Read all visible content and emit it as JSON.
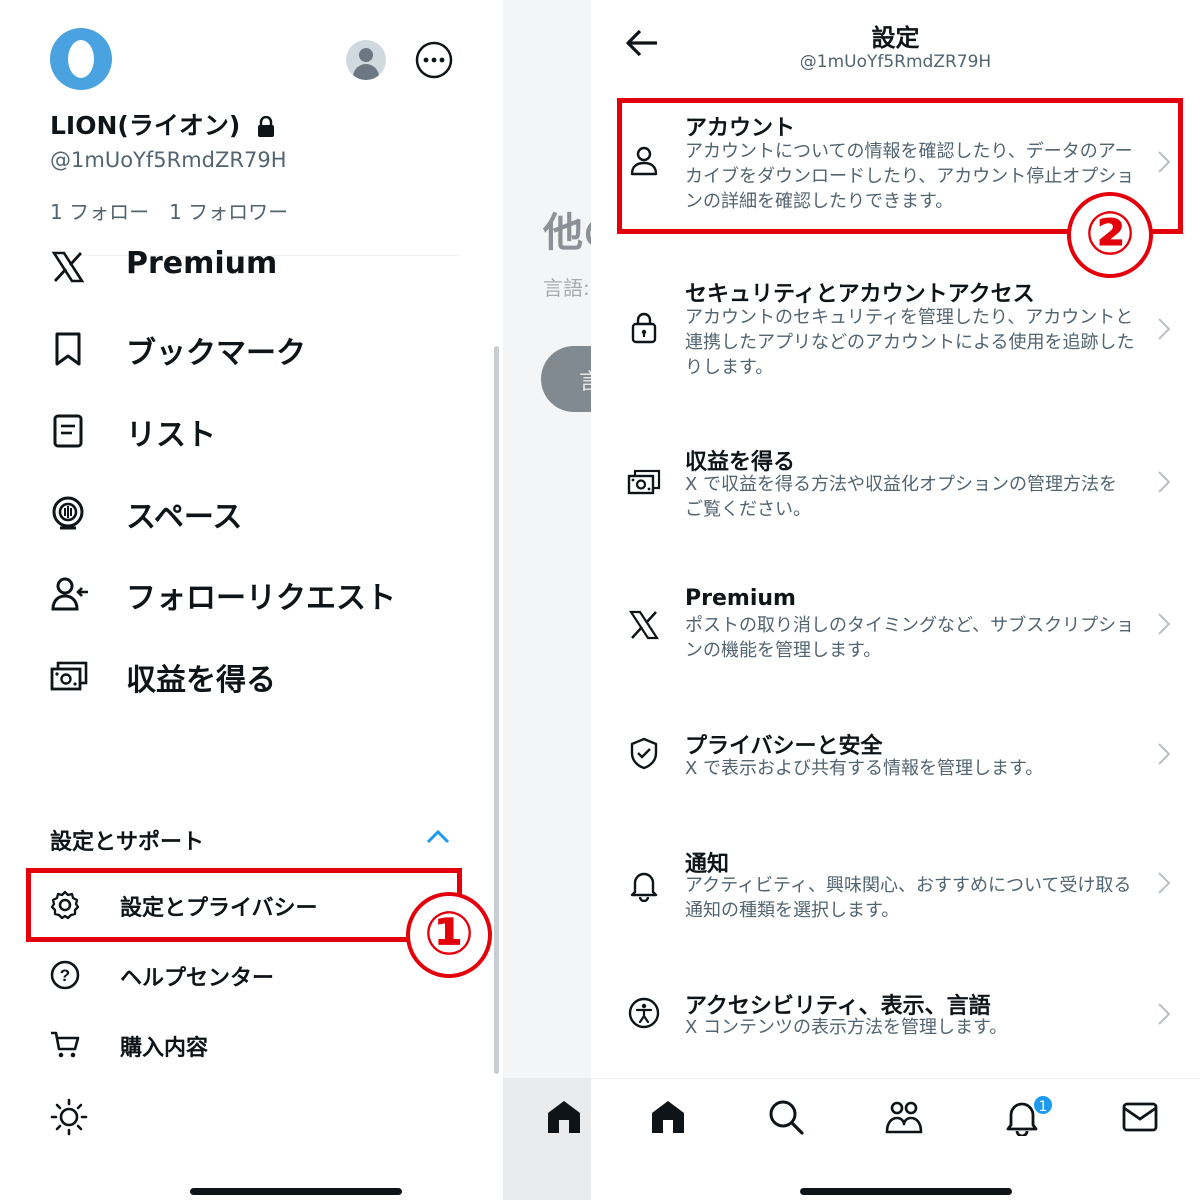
{
  "left_panel": {
    "profile": {
      "display_name": "LION(ライオン)",
      "handle": "@1mUoYf5RmdZR79H",
      "follows": "1 フォロー　1 フォロワー"
    },
    "menu": [
      {
        "label": "Premium",
        "icon": "x-logo-icon"
      },
      {
        "label": "ブックマーク",
        "icon": "bookmark-icon"
      },
      {
        "label": "リスト",
        "icon": "list-icon"
      },
      {
        "label": "スペース",
        "icon": "spaces-icon"
      },
      {
        "label": "フォローリクエスト",
        "icon": "follow-request-icon"
      },
      {
        "label": "収益を得る",
        "icon": "monetization-icon"
      }
    ],
    "section": {
      "title": "設定とサポート",
      "items": [
        {
          "label": "設定とプライバシー",
          "icon": "gear-icon"
        },
        {
          "label": "ヘルプセンター",
          "icon": "help-icon"
        },
        {
          "label": "購入内容",
          "icon": "cart-icon"
        }
      ]
    },
    "annotation": "①"
  },
  "middle_panel": {
    "heading_fragment": "他の",
    "sub_fragment": "言語:",
    "button_fragment": "言"
  },
  "settings": {
    "title": "設定",
    "handle": "@1mUoYf5RmdZR79H",
    "annotation": "②",
    "items": [
      {
        "title": "アカウント",
        "desc": "アカウントについての情報を確認したり、データのアーカイブをダウンロードしたり、アカウント停止オプションの詳細を確認したりできます。",
        "icon": "person-icon"
      },
      {
        "title": "セキュリティとアカウントアクセス",
        "desc": "アカウントのセキュリティを管理したり、アカウントと連携したアプリなどのアカウントによる使用を追跡したりします。",
        "icon": "lock-icon"
      },
      {
        "title": "収益を得る",
        "desc": "X で収益を得る方法や収益化オプションの管理方法をご覧ください。",
        "icon": "monetization-icon"
      },
      {
        "title": "Premium",
        "desc": "ポストの取り消しのタイミングなど、サブスクリプションの機能を管理します。",
        "icon": "x-logo-icon"
      },
      {
        "title": "プライバシーと安全",
        "desc": "X で表示および共有する情報を管理します。",
        "icon": "shield-icon"
      },
      {
        "title": "通知",
        "desc": "アクティビティ、興味関心、おすすめについて受け取る通知の種類を選択します。",
        "icon": "bell-icon"
      },
      {
        "title": "アクセシビリティ、表示、言語",
        "desc": "X コンテンツの表示方法を管理します。",
        "icon": "accessibility-icon"
      }
    ]
  },
  "tab_bar": {
    "notification_count": "1",
    "tabs": [
      "home-icon",
      "search-icon",
      "communities-icon",
      "bell-icon",
      "mail-icon"
    ]
  },
  "colors": {
    "accent": "#1d9bf0",
    "annotation_red": "#e3000b",
    "secondary_text": "#536471"
  }
}
